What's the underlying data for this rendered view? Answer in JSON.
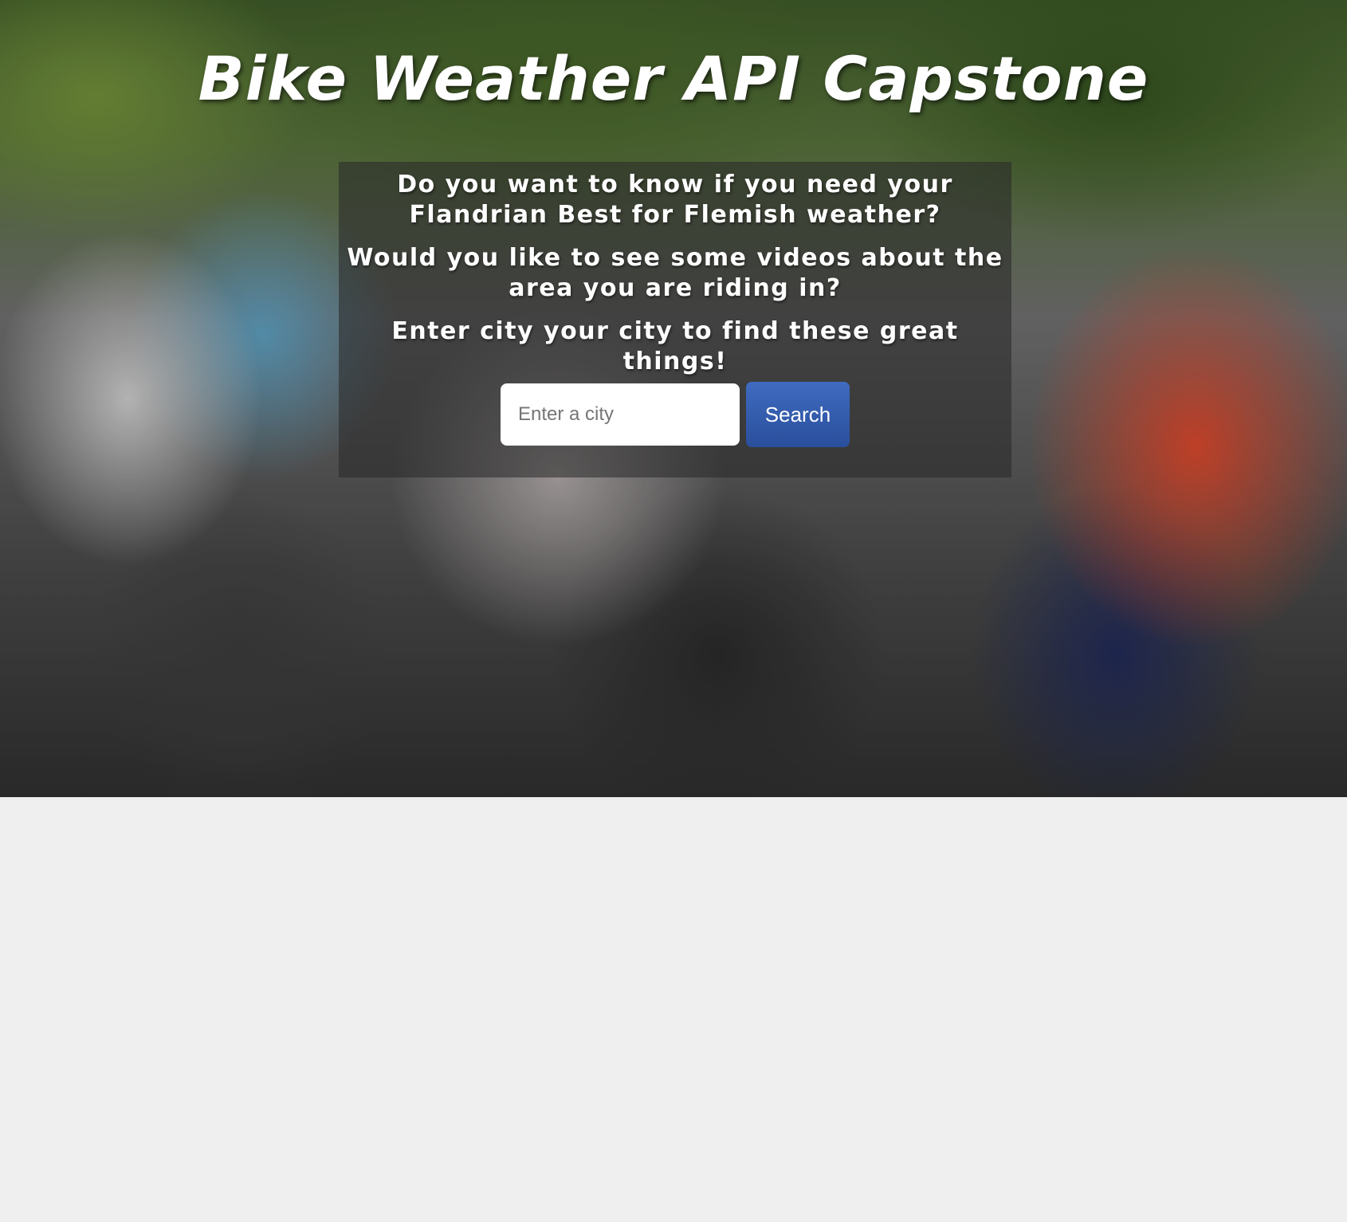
{
  "header": {
    "title": "Bike Weather API Capstone"
  },
  "intro": {
    "line1": "Do you want to know if you need your Flandrian Best for Flemish weather?",
    "line2": "Would you like to see some videos about the area you are riding in?",
    "line3": "Enter city your city to find these great things!"
  },
  "search": {
    "placeholder": "Enter a city",
    "value": "",
    "button_label": "Search"
  },
  "colors": {
    "button_blue": "#2f5aa8",
    "page_background": "#efefef"
  }
}
